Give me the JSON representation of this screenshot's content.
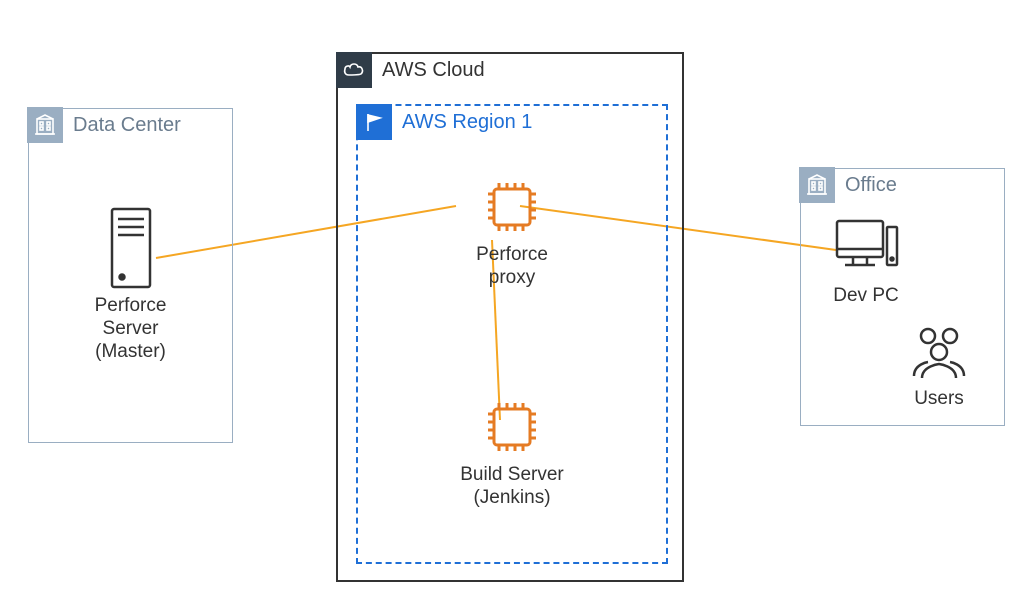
{
  "datacenter": {
    "title": "Data Center",
    "server_label_line1": "Perforce",
    "server_label_line2": "Server",
    "server_label_line3": "(Master)"
  },
  "aws_cloud": {
    "title": "AWS Cloud",
    "region": {
      "title": "AWS Region 1",
      "proxy_label_line1": "Perforce",
      "proxy_label_line2": "proxy",
      "build_label_line1": "Build Server",
      "build_label_line2": "(Jenkins)"
    }
  },
  "office": {
    "title": "Office",
    "devpc_label": "Dev PC",
    "users_label": "Users"
  },
  "colors": {
    "chip_orange": "#e57b23",
    "line_yellow": "#f5a623",
    "region_blue": "#1f6fd6",
    "muted_blue": "#9aaec2",
    "dark": "#333333"
  }
}
